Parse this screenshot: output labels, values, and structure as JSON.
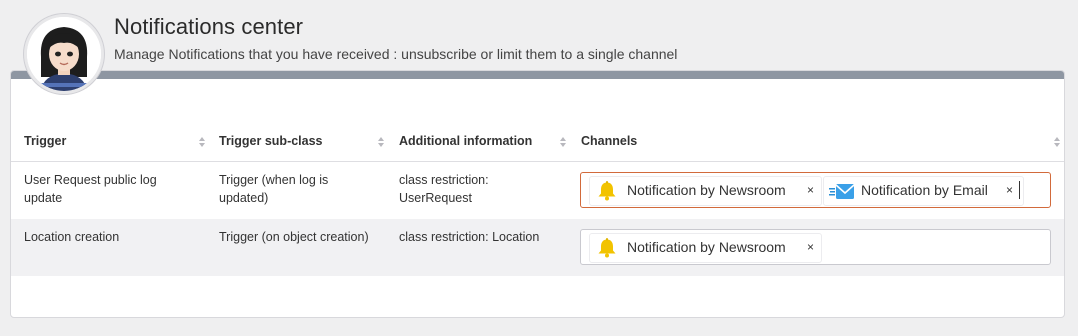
{
  "header": {
    "title": "Notifications center",
    "subtitle": "Manage Notifications that you have received : unsubscribe or limit them to a single channel"
  },
  "table": {
    "columns": [
      "Trigger",
      "Trigger sub-class",
      "Additional information",
      "Channels"
    ],
    "rows": [
      {
        "trigger_line1": "User Request public log",
        "trigger_line2": "update",
        "subclass_line1": "Trigger (when log is",
        "subclass_line2": "updated)",
        "info_line1": "class restriction:",
        "info_line2": "UserRequest",
        "channels": [
          {
            "label": "Notification by Newsroom",
            "icon": "bell-icon",
            "remove": "×"
          },
          {
            "label": "Notification by Email",
            "icon": "envelope-icon",
            "remove": "×"
          }
        ]
      },
      {
        "trigger_line1": "Location creation",
        "subclass_line1": "Trigger (on object creation)",
        "info_line1": "class restriction: Location",
        "channels": [
          {
            "label": "Notification by Newsroom",
            "icon": "bell-icon",
            "remove": "×"
          }
        ]
      }
    ]
  },
  "colors": {
    "panel_bar": "#8e96a2",
    "focus_border": "#d26a3b",
    "bell": "#f2c300",
    "envelope": "#2a8fd6"
  }
}
